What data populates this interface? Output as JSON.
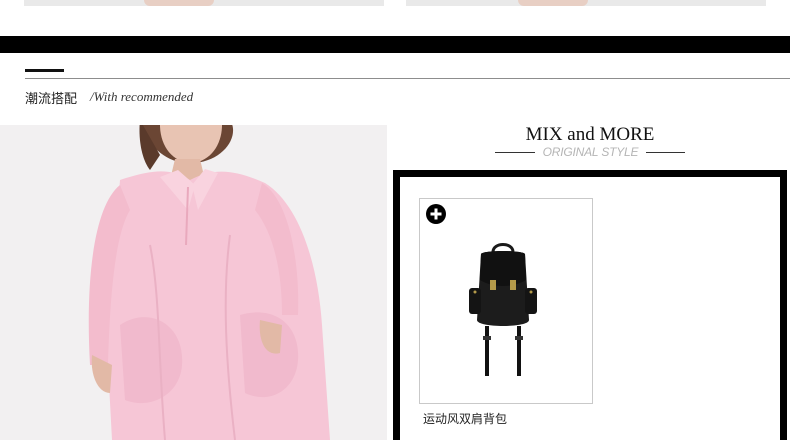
{
  "section": {
    "title": "潮流搭配",
    "subtitle": "/With recommended"
  },
  "mix": {
    "title": "MIX and MORE",
    "subtitle": "ORIGINAL STYLE",
    "accent_color": "#000000"
  },
  "product": {
    "name": "运动风双肩背包",
    "add_icon": "plus-circle-icon"
  },
  "images": {
    "model": "model-in-pink-shirt-dress",
    "product": "black-nylon-backpack"
  }
}
